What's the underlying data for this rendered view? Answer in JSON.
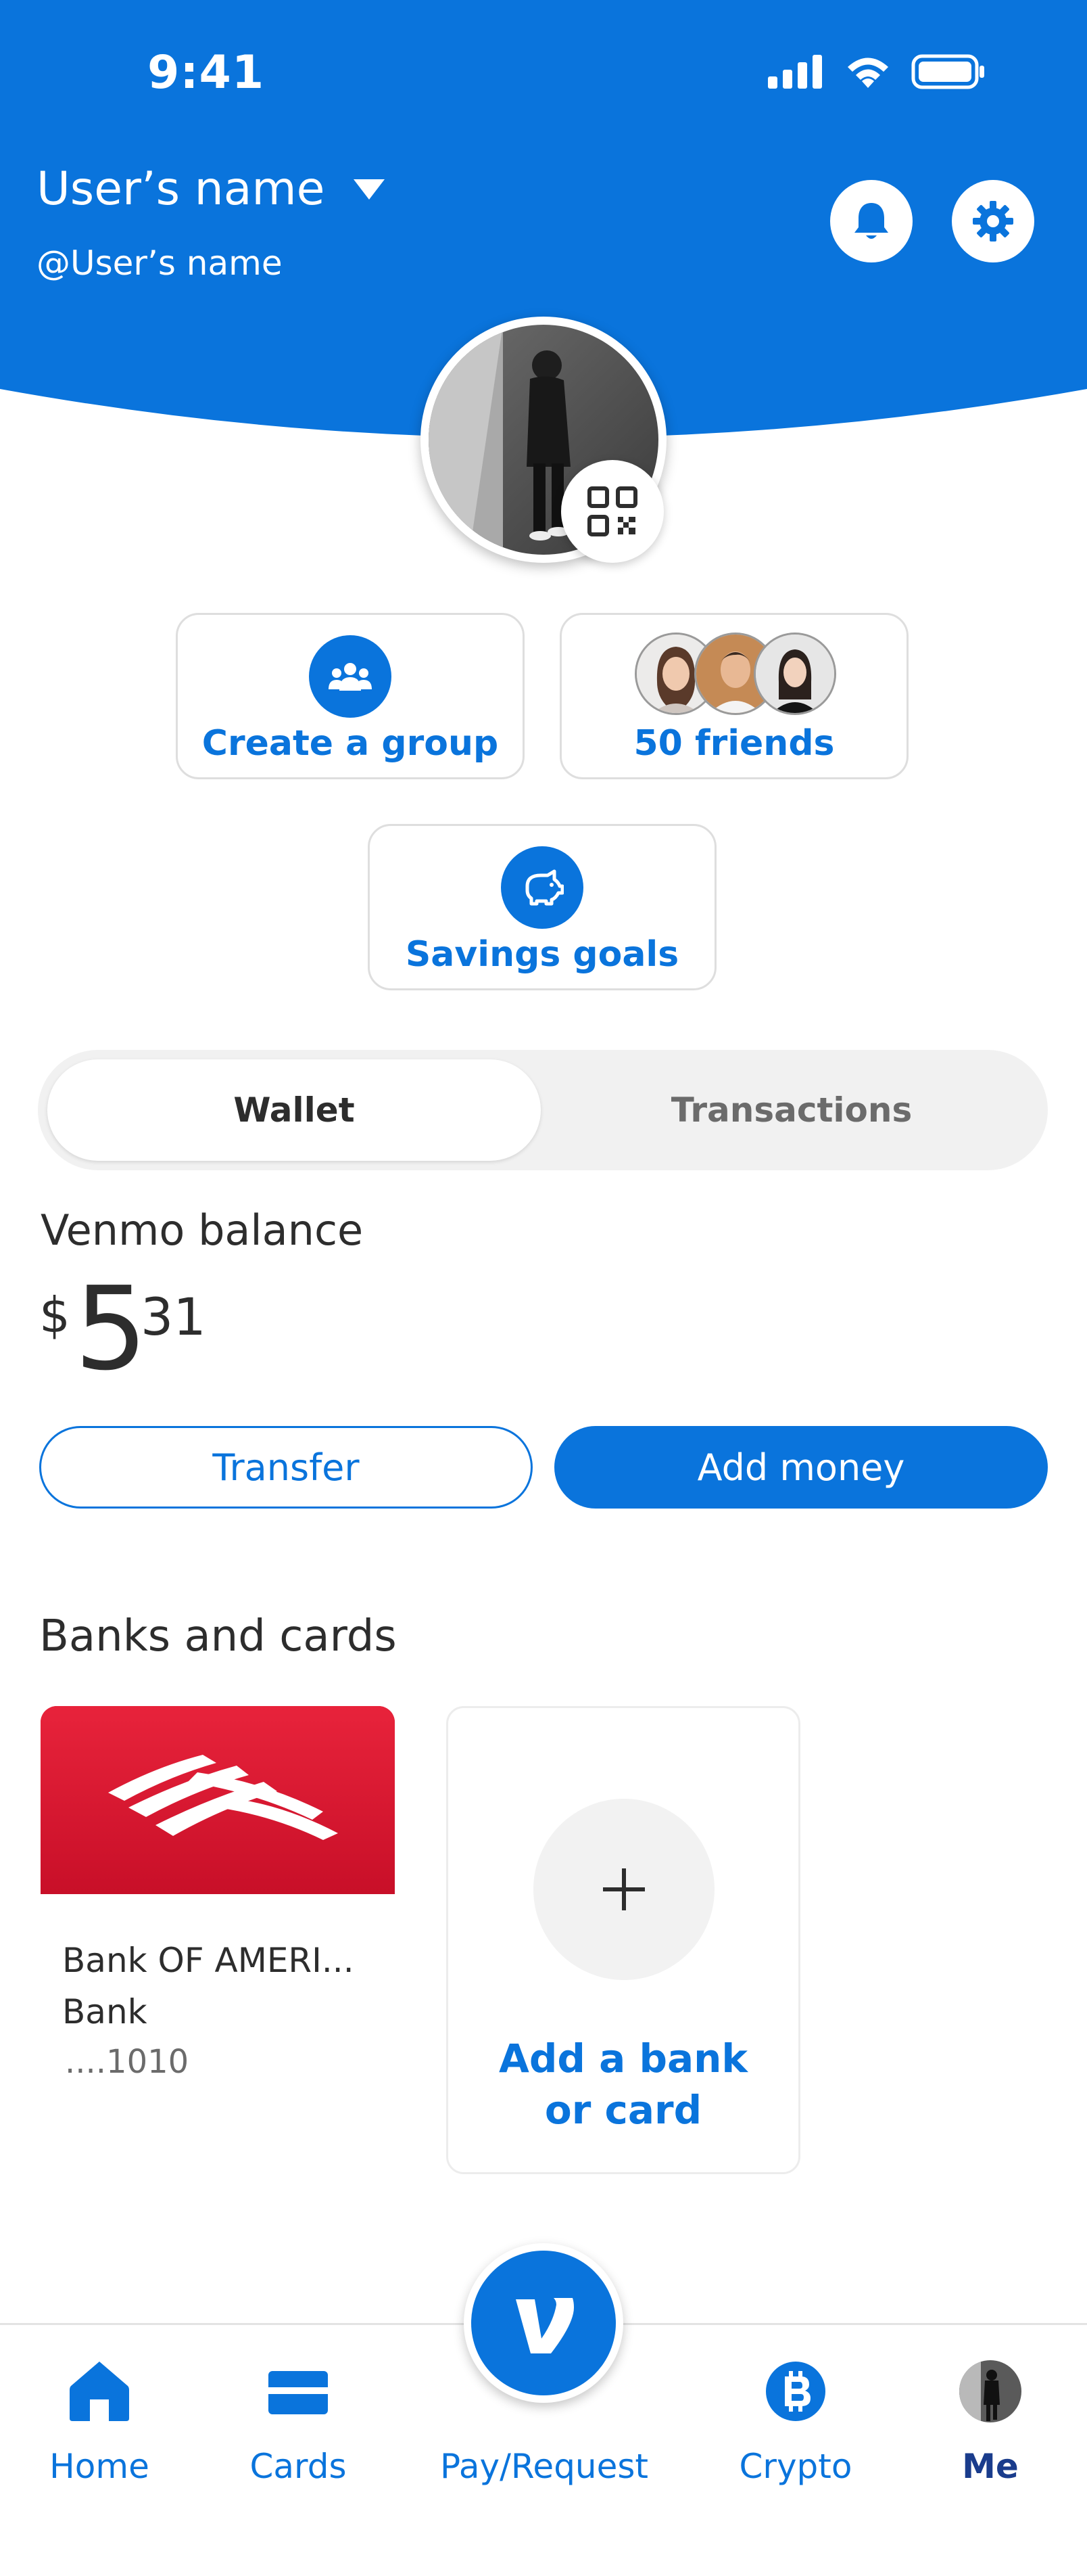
{
  "status_bar": {
    "time": "9:41"
  },
  "header": {
    "username": "User’s name",
    "handle": "@User’s name",
    "icons": [
      "chevron-down-icon",
      "bell-icon",
      "gear-icon",
      "qr-code-icon"
    ]
  },
  "tiles": {
    "create_group": {
      "label": "Create a group",
      "icon": "group-icon"
    },
    "friends": {
      "label": "50 friends"
    },
    "savings": {
      "label": "Savings goals",
      "icon": "piggy-bank-icon"
    }
  },
  "segment": {
    "wallet": "Wallet",
    "transactions": "Transactions"
  },
  "wallet": {
    "balance_label": "Venmo balance",
    "currency": "$",
    "balance_int": "5",
    "balance_dec": "31",
    "transfer_label": "Transfer",
    "add_money_label": "Add money"
  },
  "banks": {
    "title": "Banks and cards",
    "bank_name_line1": "Bank OF AMERI...",
    "bank_name_line2": "Bank",
    "bank_number": "....1010",
    "add_line1": "Add a bank",
    "add_line2": "or card"
  },
  "nav": {
    "home": "Home",
    "cards": "Cards",
    "pay": "Pay/Request",
    "crypto": "Crypto",
    "me": "Me"
  },
  "colors": {
    "brand_blue": "#0a74dc",
    "nav_active": "#1a3c8c",
    "bank_red": "#d4112b"
  }
}
